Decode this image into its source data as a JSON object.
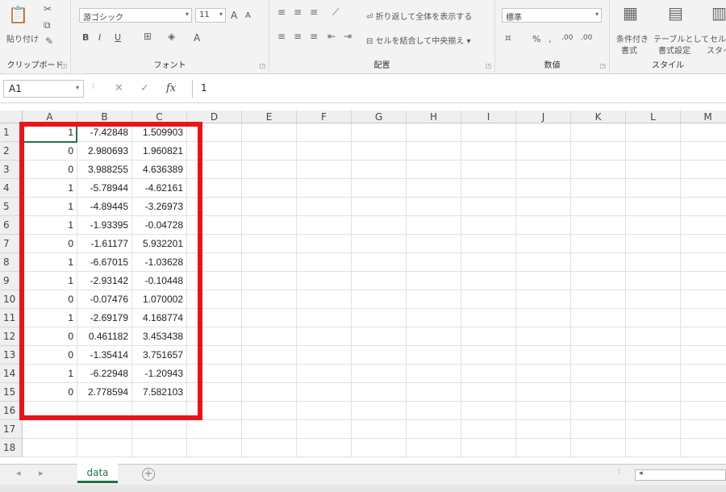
{
  "ribbon": {
    "clipboard": {
      "paste": "貼り付け",
      "label": "クリップボード"
    },
    "font": {
      "name": "游ゴシック",
      "size": "11",
      "grow": "A",
      "shrink": "A",
      "bold": "B",
      "italic": "I",
      "underline": "U",
      "color_a": "A",
      "label": "フォント"
    },
    "alignment": {
      "wrap": "折り返して全体を表示する",
      "merge": "セルを結合して中央揃え",
      "label": "配置"
    },
    "number": {
      "format": "標準",
      "percent": "%",
      "comma": ",",
      "inc": ".00",
      "dec": ".00",
      "label": "数値"
    },
    "styles": {
      "cond1": "条件付き",
      "cond2": "書式",
      "table1": "テーブルとして",
      "table2": "書式設定",
      "cell1": "セル",
      "cell2": "スタイ",
      "label": "スタイル"
    }
  },
  "formula_bar": {
    "name_box": "A1",
    "cancel": "✕",
    "enter": "✓",
    "fx": "fx",
    "value": "1"
  },
  "columns": [
    "A",
    "B",
    "C",
    "D",
    "E",
    "F",
    "G",
    "H",
    "I",
    "J",
    "K",
    "L",
    "M"
  ],
  "rows": [
    "1",
    "2",
    "3",
    "4",
    "5",
    "6",
    "7",
    "8",
    "9",
    "10",
    "11",
    "12",
    "13",
    "14",
    "15",
    "16",
    "17",
    "18"
  ],
  "cells": [
    [
      "1",
      "-7.42848",
      "1.509903"
    ],
    [
      "0",
      "2.980693",
      "1.960821"
    ],
    [
      "0",
      "3.988255",
      "4.636389"
    ],
    [
      "1",
      "-5.78944",
      "-4.62161"
    ],
    [
      "1",
      "-4.89445",
      "-3.26973"
    ],
    [
      "1",
      "-1.93395",
      "-0.04728"
    ],
    [
      "0",
      "-1.61177",
      "5.932201"
    ],
    [
      "1",
      "-6.67015",
      "-1.03628"
    ],
    [
      "1",
      "-2.93142",
      "-0.10448"
    ],
    [
      "0",
      "-0.07476",
      "1.070002"
    ],
    [
      "1",
      "-2.69179",
      "4.168774"
    ],
    [
      "0",
      "0.461182",
      "3.453438"
    ],
    [
      "0",
      "-1.35414",
      "3.751657"
    ],
    [
      "1",
      "-6.22948",
      "-1.20943"
    ],
    [
      "0",
      "2.778594",
      "7.582103"
    ]
  ],
  "sheet_tabs": {
    "active": "data",
    "add": "+"
  },
  "colors": {
    "accent": "#217346",
    "highlight": "#e8141b"
  }
}
